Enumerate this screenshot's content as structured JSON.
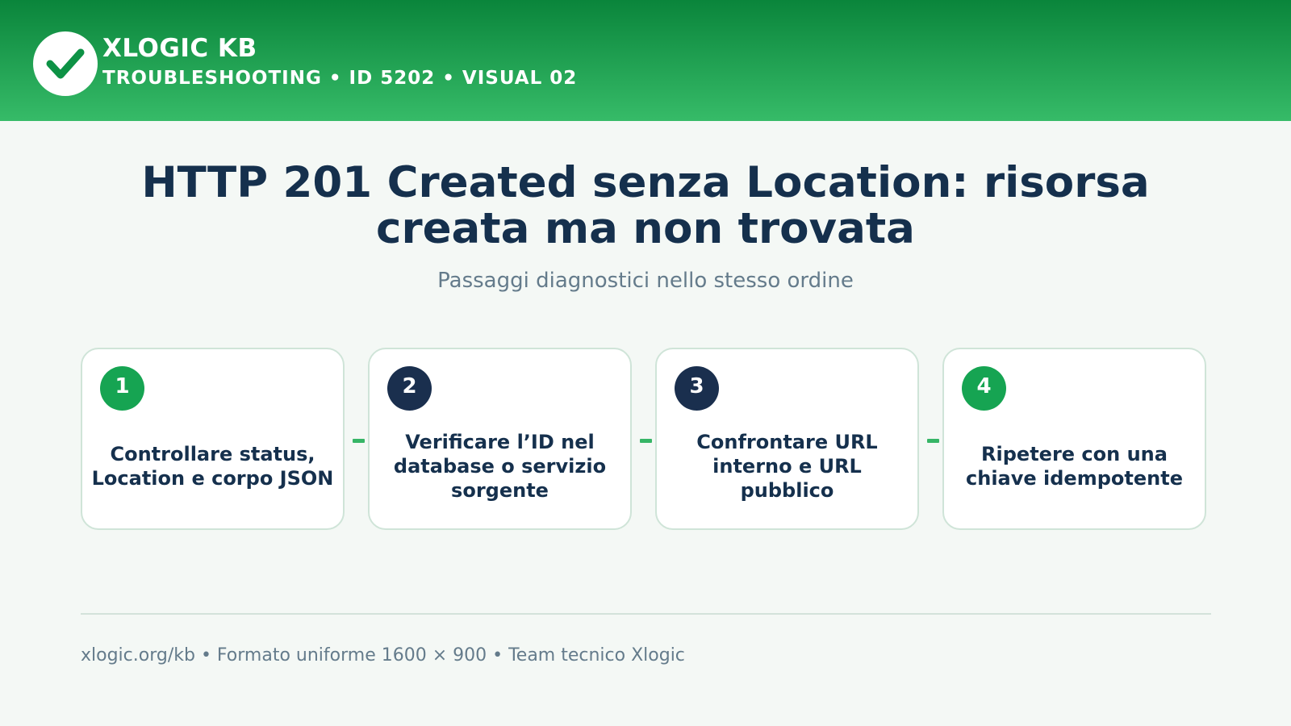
{
  "header": {
    "brand": "XLOGIC KB",
    "meta": "TROUBLESHOOTING • ID 5202 • VISUAL 02",
    "logo_icon": "check-icon"
  },
  "title": "HTTP 201 Created senza Location: risorsa creata ma non trovata",
  "subtitle": "Passaggi diagnostici nello stesso ordine",
  "steps": [
    {
      "number": "1",
      "text": "Controllare status, Location e corpo JSON",
      "badge_color": "#16a452"
    },
    {
      "number": "2",
      "text": "Verificare l’ID nel database o servizio sorgente",
      "badge_color": "#1a2f4e"
    },
    {
      "number": "3",
      "text": "Confrontare URL interno e URL pubblico",
      "badge_color": "#1a2f4e"
    },
    {
      "number": "4",
      "text": "Ripetere con una chiave idempotente",
      "badge_color": "#16a452"
    }
  ],
  "footer": "xlogic.org/kb • Formato uniforme 1600 × 900 • Team tecnico Xlogic",
  "colors": {
    "header_gradient_top": "#0a853b",
    "header_gradient_bottom": "#36bb68",
    "title": "#15304d",
    "accent_green": "#16a452",
    "accent_navy": "#1a2f4e",
    "connector": "#36b566"
  }
}
